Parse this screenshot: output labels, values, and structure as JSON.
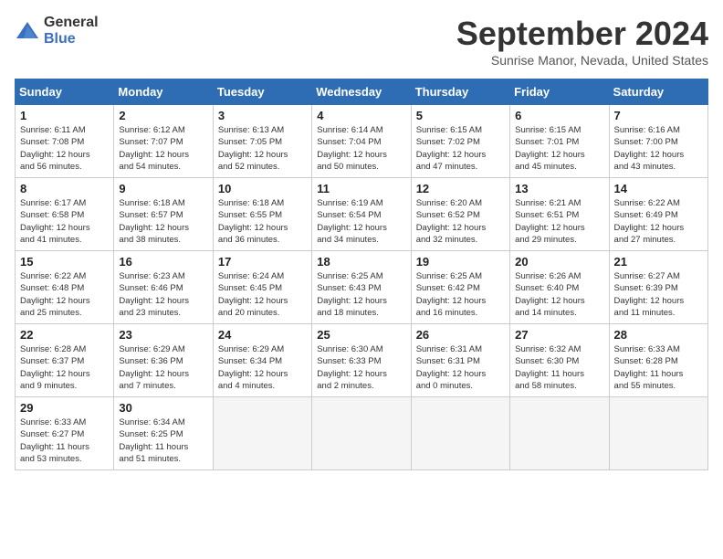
{
  "header": {
    "logo_general": "General",
    "logo_blue": "Blue",
    "month_title": "September 2024",
    "location": "Sunrise Manor, Nevada, United States"
  },
  "weekdays": [
    "Sunday",
    "Monday",
    "Tuesday",
    "Wednesday",
    "Thursday",
    "Friday",
    "Saturday"
  ],
  "weeks": [
    [
      {
        "day": "1",
        "info": "Sunrise: 6:11 AM\nSunset: 7:08 PM\nDaylight: 12 hours\nand 56 minutes."
      },
      {
        "day": "2",
        "info": "Sunrise: 6:12 AM\nSunset: 7:07 PM\nDaylight: 12 hours\nand 54 minutes."
      },
      {
        "day": "3",
        "info": "Sunrise: 6:13 AM\nSunset: 7:05 PM\nDaylight: 12 hours\nand 52 minutes."
      },
      {
        "day": "4",
        "info": "Sunrise: 6:14 AM\nSunset: 7:04 PM\nDaylight: 12 hours\nand 50 minutes."
      },
      {
        "day": "5",
        "info": "Sunrise: 6:15 AM\nSunset: 7:02 PM\nDaylight: 12 hours\nand 47 minutes."
      },
      {
        "day": "6",
        "info": "Sunrise: 6:15 AM\nSunset: 7:01 PM\nDaylight: 12 hours\nand 45 minutes."
      },
      {
        "day": "7",
        "info": "Sunrise: 6:16 AM\nSunset: 7:00 PM\nDaylight: 12 hours\nand 43 minutes."
      }
    ],
    [
      {
        "day": "8",
        "info": "Sunrise: 6:17 AM\nSunset: 6:58 PM\nDaylight: 12 hours\nand 41 minutes."
      },
      {
        "day": "9",
        "info": "Sunrise: 6:18 AM\nSunset: 6:57 PM\nDaylight: 12 hours\nand 38 minutes."
      },
      {
        "day": "10",
        "info": "Sunrise: 6:18 AM\nSunset: 6:55 PM\nDaylight: 12 hours\nand 36 minutes."
      },
      {
        "day": "11",
        "info": "Sunrise: 6:19 AM\nSunset: 6:54 PM\nDaylight: 12 hours\nand 34 minutes."
      },
      {
        "day": "12",
        "info": "Sunrise: 6:20 AM\nSunset: 6:52 PM\nDaylight: 12 hours\nand 32 minutes."
      },
      {
        "day": "13",
        "info": "Sunrise: 6:21 AM\nSunset: 6:51 PM\nDaylight: 12 hours\nand 29 minutes."
      },
      {
        "day": "14",
        "info": "Sunrise: 6:22 AM\nSunset: 6:49 PM\nDaylight: 12 hours\nand 27 minutes."
      }
    ],
    [
      {
        "day": "15",
        "info": "Sunrise: 6:22 AM\nSunset: 6:48 PM\nDaylight: 12 hours\nand 25 minutes."
      },
      {
        "day": "16",
        "info": "Sunrise: 6:23 AM\nSunset: 6:46 PM\nDaylight: 12 hours\nand 23 minutes."
      },
      {
        "day": "17",
        "info": "Sunrise: 6:24 AM\nSunset: 6:45 PM\nDaylight: 12 hours\nand 20 minutes."
      },
      {
        "day": "18",
        "info": "Sunrise: 6:25 AM\nSunset: 6:43 PM\nDaylight: 12 hours\nand 18 minutes."
      },
      {
        "day": "19",
        "info": "Sunrise: 6:25 AM\nSunset: 6:42 PM\nDaylight: 12 hours\nand 16 minutes."
      },
      {
        "day": "20",
        "info": "Sunrise: 6:26 AM\nSunset: 6:40 PM\nDaylight: 12 hours\nand 14 minutes."
      },
      {
        "day": "21",
        "info": "Sunrise: 6:27 AM\nSunset: 6:39 PM\nDaylight: 12 hours\nand 11 minutes."
      }
    ],
    [
      {
        "day": "22",
        "info": "Sunrise: 6:28 AM\nSunset: 6:37 PM\nDaylight: 12 hours\nand 9 minutes."
      },
      {
        "day": "23",
        "info": "Sunrise: 6:29 AM\nSunset: 6:36 PM\nDaylight: 12 hours\nand 7 minutes."
      },
      {
        "day": "24",
        "info": "Sunrise: 6:29 AM\nSunset: 6:34 PM\nDaylight: 12 hours\nand 4 minutes."
      },
      {
        "day": "25",
        "info": "Sunrise: 6:30 AM\nSunset: 6:33 PM\nDaylight: 12 hours\nand 2 minutes."
      },
      {
        "day": "26",
        "info": "Sunrise: 6:31 AM\nSunset: 6:31 PM\nDaylight: 12 hours\nand 0 minutes."
      },
      {
        "day": "27",
        "info": "Sunrise: 6:32 AM\nSunset: 6:30 PM\nDaylight: 11 hours\nand 58 minutes."
      },
      {
        "day": "28",
        "info": "Sunrise: 6:33 AM\nSunset: 6:28 PM\nDaylight: 11 hours\nand 55 minutes."
      }
    ],
    [
      {
        "day": "29",
        "info": "Sunrise: 6:33 AM\nSunset: 6:27 PM\nDaylight: 11 hours\nand 53 minutes."
      },
      {
        "day": "30",
        "info": "Sunrise: 6:34 AM\nSunset: 6:25 PM\nDaylight: 11 hours\nand 51 minutes."
      },
      {
        "day": "",
        "info": ""
      },
      {
        "day": "",
        "info": ""
      },
      {
        "day": "",
        "info": ""
      },
      {
        "day": "",
        "info": ""
      },
      {
        "day": "",
        "info": ""
      }
    ]
  ]
}
